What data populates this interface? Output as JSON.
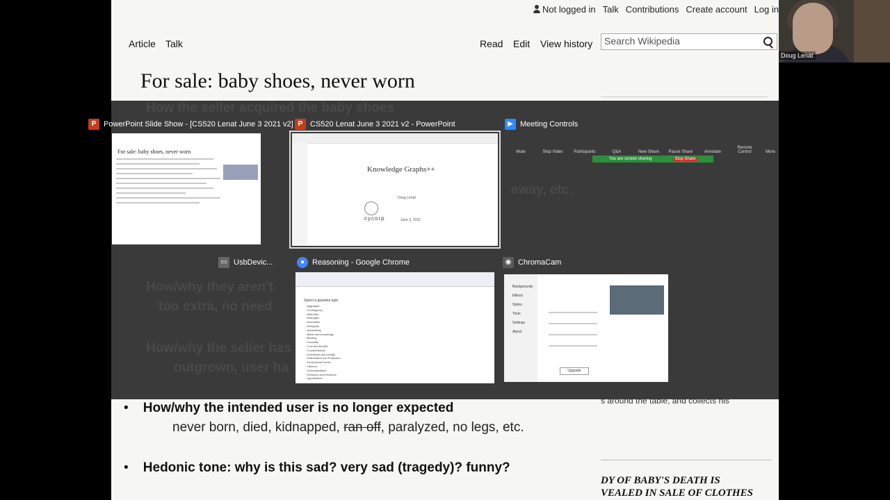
{
  "wiki": {
    "not_logged_in": "Not logged in",
    "talk_top": "Talk",
    "contributions": "Contributions",
    "create_account": "Create account",
    "log_in": "Log in",
    "tab_article": "Article",
    "tab_talk": "Talk",
    "tab_read": "Read",
    "tab_edit": "Edit",
    "tab_history": "View history",
    "search_placeholder": "Search Wikipedia"
  },
  "slide": {
    "title": "For sale: baby shoes, never worn",
    "bullet_user": "How/why the intended user is no longer expected",
    "user_sub_a": "never born, died, kidnapped, ",
    "user_sub_strike": "ran off",
    "user_sub_b": ", paralyzed, no legs, etc.",
    "bullet_tone": "Hedonic tone: why is this sad? very sad (tragedy)?  funny?",
    "side_caption": "s around the table, and collects his",
    "side_heading_1": "DY OF BABY'S DEATH IS",
    "side_heading_2": "VEALED IN SALE OF CLOTHES",
    "ghost_1": "How the seller acquired the baby shoes",
    "ghost_2": "away, etc.",
    "ghost_3": "How/why they aren't",
    "ghost_4": "too extra, no need",
    "ghost_5": "How/why the seller has",
    "ghost_6": "outgrown, user ha"
  },
  "switcher": {
    "windows": [
      {
        "title": "PowerPoint Slide Show - [CS520 Lenat June 3 2021 v2]",
        "icon": "powerpoint-icon",
        "color": "#c43e1c"
      },
      {
        "title": "CS520 Lenat June 3 2021 v2 - PowerPoint",
        "icon": "powerpoint-icon",
        "color": "#c43e1c"
      },
      {
        "title": "Meeting Controls",
        "icon": "zoom-camera-icon",
        "color": "#2d8cff"
      },
      {
        "title": "UsbDevic...",
        "icon": "usb-device-icon",
        "color": "#666666"
      },
      {
        "title": "Reasoning - Google Chrome",
        "icon": "chrome-icon",
        "color": "#4285f4"
      },
      {
        "title": "ChromaCam",
        "icon": "chromacam-icon",
        "color": "#5a5a5a"
      }
    ],
    "ppt_thumb": {
      "slide_title": "Knowledge Graphs++",
      "brand": "cycorp",
      "author": "Doug Lenat",
      "date": "June 3, 2021"
    },
    "meeting": {
      "sharing_notice": "You are screen sharing",
      "stop_share": "Stop Share",
      "controls": [
        "Mute",
        "Stop Video",
        "Participants",
        "Q&A",
        "New Share",
        "Pause Share",
        "Annotate",
        "Remote Control",
        "More"
      ]
    },
    "chrome_thumb": {
      "list_heading": "Select a question type",
      "items": [
        "Aggregate",
        "Contingency",
        "Attributes",
        "Analogies",
        "Anomalies",
        "Ambiguity",
        "Authenticity",
        "Belief and Knowledge",
        "Binding",
        "Causality",
        "Cost and Benefit",
        "Counterfactual",
        "Definitions and Identity",
        "Deliberation and Prediction",
        "Exceptional Events",
        "Failures",
        "Generalizations",
        "Hedonics and Emotions",
        "Hypothetical"
      ]
    },
    "chromacam_thumb": {
      "menu": [
        "Backgrounds",
        "Effects",
        "Styles",
        "Tools",
        "Settings",
        "About"
      ],
      "button": "Upgrade"
    }
  },
  "webcam": {
    "name": "Doug Lenat"
  },
  "colors": {
    "overlay": "#3a3a3a",
    "page_bg": "#f6f6f4",
    "zoom_blue": "#2d8cff"
  }
}
